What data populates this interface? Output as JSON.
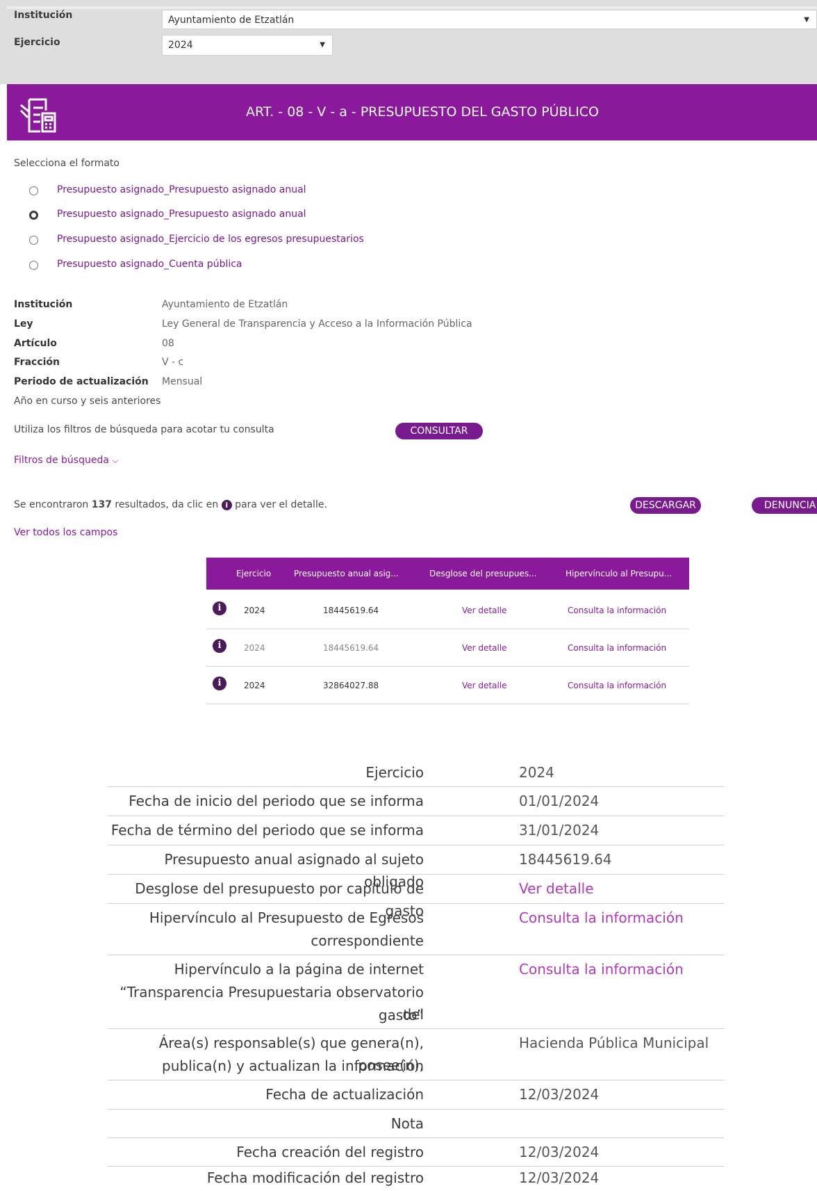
{
  "topbar": {
    "institucion_label": "Institución",
    "institucion_value": "Ayuntamiento de Etzatlán",
    "ejercicio_label": "Ejercicio",
    "ejercicio_value": "2024"
  },
  "banner": {
    "title": "ART. - 08 - V - a - PRESUPUESTO DEL GASTO PÚBLICO",
    "icon": "budget-document-icon"
  },
  "formato": {
    "prompt": "Selecciona el formato",
    "options": [
      {
        "label": "Presupuesto asignado_Presupuesto asignado anual",
        "selected": false
      },
      {
        "label": "Presupuesto asignado_Presupuesto asignado anual",
        "selected": true
      },
      {
        "label": "Presupuesto asignado_Ejercicio de los egresos presupuestarios",
        "selected": false
      },
      {
        "label": "Presupuesto asignado_Cuenta pública",
        "selected": false
      }
    ]
  },
  "meta": {
    "institucion_k": "Institución",
    "institucion_v": "Ayuntamiento de Etzatlán",
    "ley_k": "Ley",
    "ley_v": "Ley General de Transparencia y Acceso a la Información Pública",
    "articulo_k": "Artículo",
    "articulo_v": "08",
    "fraccion_k": "Fracción",
    "fraccion_v": "V - c",
    "periodo_k": "Periodo de actualización",
    "periodo_v": "Mensual",
    "conservacion": "Año en curso y seis anteriores"
  },
  "search": {
    "hint": "Utiliza los filtros de búsqueda para acotar tu consulta",
    "consultar": "CONSULTAR",
    "filtros": "Filtros de búsqueda"
  },
  "results": {
    "prefix": "Se encontraron ",
    "count": "137",
    "suffix1": " resultados, da clic en ",
    "suffix2": " para ver el detalle.",
    "descargar": "DESCARGAR",
    "denuncia": "DENUNCIA",
    "ver_todos": "Ver todos los campos"
  },
  "table": {
    "headers": [
      "Ejercicio",
      "Presupuesto anual asig...",
      "Desglose del presupues...",
      "Hipervínculo al Presupu..."
    ],
    "rows": [
      {
        "ejercicio": "2024",
        "presupuesto": "18445619.64",
        "desglose": "Ver detalle",
        "hipervinculo": "Consulta la información"
      },
      {
        "ejercicio": "2024",
        "presupuesto": "18445619.64",
        "desglose": "Ver detalle",
        "hipervinculo": "Consulta la información"
      },
      {
        "ejercicio": "2024",
        "presupuesto": "32864027.88",
        "desglose": "Ver detalle",
        "hipervinculo": "Consulta la información"
      }
    ]
  },
  "detail": [
    {
      "k": "Ejercicio",
      "v": "2024"
    },
    {
      "k": "Fecha de inicio del periodo que se informa",
      "v": "01/01/2024"
    },
    {
      "k": "Fecha de término del periodo que se informa",
      "v": "31/01/2024"
    },
    {
      "k": "Presupuesto anual asignado al sujeto obligado",
      "v": "18445619.64"
    },
    {
      "k": "Desglose del presupuesto por capítulo de gasto",
      "v": "Ver detalle"
    },
    {
      "k1": "Hipervínculo al Presupuesto de Egresos",
      "k2": "correspondiente",
      "v": "Consulta la información"
    },
    {
      "k1": "Hipervínculo a la página de internet",
      "k2": "“Transparencia Presupuestaria observatorio del",
      "k3": "gasto”",
      "v": "Consulta la información"
    },
    {
      "k1": "Área(s) responsable(s) que genera(n), posee(n),",
      "k2": "publica(n) y actualizan la información",
      "v": "Hacienda Pública Municipal"
    },
    {
      "k": "Fecha de actualización",
      "v": "12/03/2024"
    },
    {
      "k": "Nota",
      "v": ""
    },
    {
      "k": "Fecha creación del registro",
      "v": "12/03/2024"
    },
    {
      "k": "Fecha modificación del registro",
      "v": "12/03/2024"
    }
  ]
}
